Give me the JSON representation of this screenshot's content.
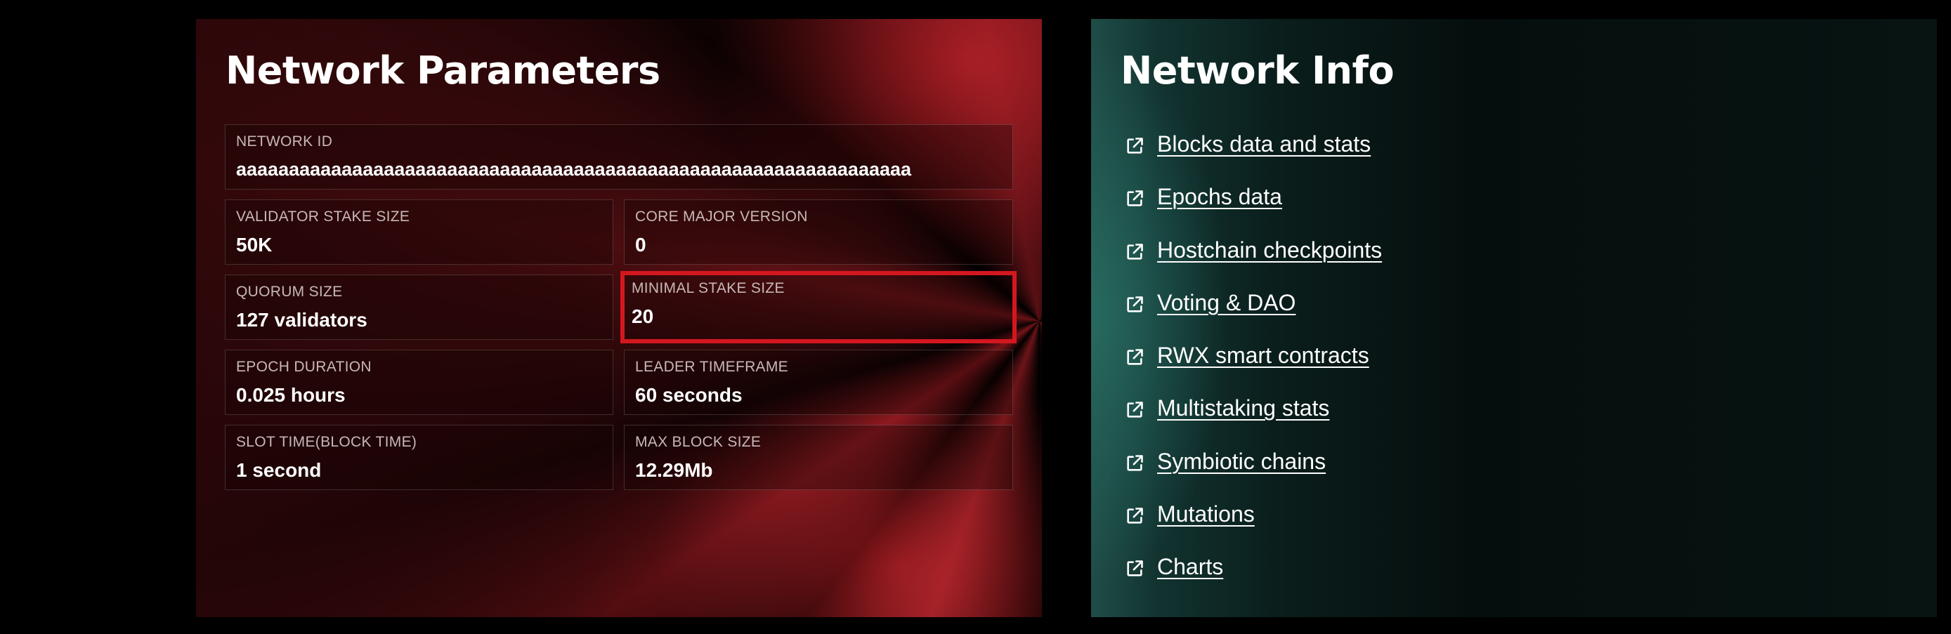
{
  "network_parameters": {
    "title": "Network Parameters",
    "network_id": {
      "label": "NETWORK ID",
      "value": "aaaaaaaaaaaaaaaaaaaaaaaaaaaaaaaaaaaaaaaaaaaaaaaaaaaaaaaaaaaaaaaa"
    },
    "validator_stake_size": {
      "label": "VALIDATOR STAKE SIZE",
      "value": "50K"
    },
    "core_major_version": {
      "label": "CORE MAJOR VERSION",
      "value": "0"
    },
    "quorum_size": {
      "label": "QUORUM SIZE",
      "value": "127 validators"
    },
    "minimal_stake_size": {
      "label": "MINIMAL STAKE SIZE",
      "value": "20"
    },
    "epoch_duration": {
      "label": "EPOCH DURATION",
      "value": "0.025 hours"
    },
    "leader_timeframe": {
      "label": "LEADER TIMEFRAME",
      "value": "60 seconds"
    },
    "slot_time": {
      "label": "SLOT TIME(BLOCK TIME)",
      "value": "1 second"
    },
    "max_block_size": {
      "label": "MAX BLOCK SIZE",
      "value": "12.29Mb"
    }
  },
  "network_info": {
    "title": "Network Info",
    "links": [
      {
        "label": "Blocks data and stats",
        "icon": "external-link-icon"
      },
      {
        "label": "Epochs data",
        "icon": "external-link-icon"
      },
      {
        "label": "Hostchain checkpoints",
        "icon": "external-link-icon"
      },
      {
        "label": "Voting & DAO",
        "icon": "external-link-icon"
      },
      {
        "label": "RWX smart contracts",
        "icon": "external-link-icon"
      },
      {
        "label": "Multistaking stats",
        "icon": "external-link-icon"
      },
      {
        "label": "Symbiotic chains",
        "icon": "external-link-icon"
      },
      {
        "label": "Mutations",
        "icon": "external-link-icon"
      },
      {
        "label": "Charts",
        "icon": "external-link-icon"
      }
    ]
  },
  "colors": {
    "highlight_border": "#d4171f",
    "left_panel_accent": "#7a1419",
    "right_panel_accent": "#1f4d47"
  }
}
